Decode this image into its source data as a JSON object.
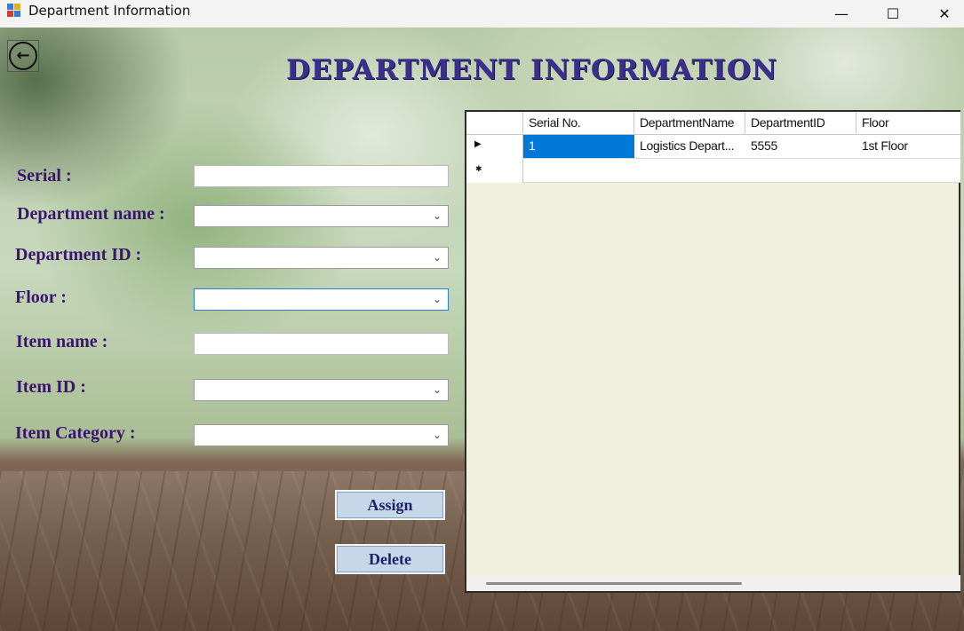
{
  "window": {
    "title": "Department Information",
    "minimize_glyph": "—",
    "maximize_glyph": "☐",
    "close_glyph": "✕"
  },
  "header": {
    "back_glyph": "←",
    "title": "DEPARTMENT INFORMATION"
  },
  "form": {
    "serial_label": "Serial :",
    "serial_value": "",
    "department_name_label": "Department name :",
    "department_name_value": "",
    "department_id_label": "Department ID :",
    "department_id_value": "",
    "floor_label": "Floor :",
    "floor_value": "",
    "item_name_label": "Item name :",
    "item_name_value": "",
    "item_id_label": "Item ID :",
    "item_id_value": "",
    "item_category_label": "Item Category :",
    "item_category_value": "",
    "combo_arrow": "⌄"
  },
  "buttons": {
    "assign": "Assign",
    "delete": "Delete"
  },
  "grid": {
    "columns": [
      "Serial No.",
      "DepartmentName",
      "DepartmentID",
      "Floor"
    ],
    "rows": [
      [
        "1",
        "Logistics Depart...",
        "5555",
        "1st Floor"
      ]
    ],
    "current_row_glyph": "▶",
    "new_row_glyph": "✱"
  },
  "colors": {
    "title": "#3c2f8c",
    "labels": "#3b1470",
    "button_bg": "#c6d7ea",
    "grid_bg": "#f0f0dc",
    "selection": "#0078d7"
  }
}
